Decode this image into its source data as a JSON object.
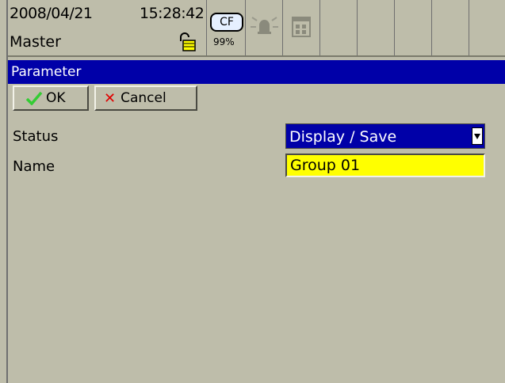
{
  "status_bar": {
    "date": "2008/04/21",
    "time": "15:28:42",
    "user": "Master",
    "cf_label": "CF",
    "cf_usage": "99%"
  },
  "title": "Parameter",
  "toolbar": {
    "ok_label": "OK",
    "cancel_label": "Cancel"
  },
  "fields": {
    "status_label": "Status",
    "status_value": "Display / Save",
    "name_label": "Name",
    "name_value": "Group 01"
  },
  "colors": {
    "background": "#bebdaa",
    "title_bar": "#0000a8",
    "input_highlight": "#ffff00",
    "ok_check": "#33cc33",
    "cancel_x": "#e00000"
  },
  "icons": {
    "lock": "padlock-open-icon",
    "alarm": "alarm-bell-icon",
    "calendar": "calendar-icon"
  }
}
